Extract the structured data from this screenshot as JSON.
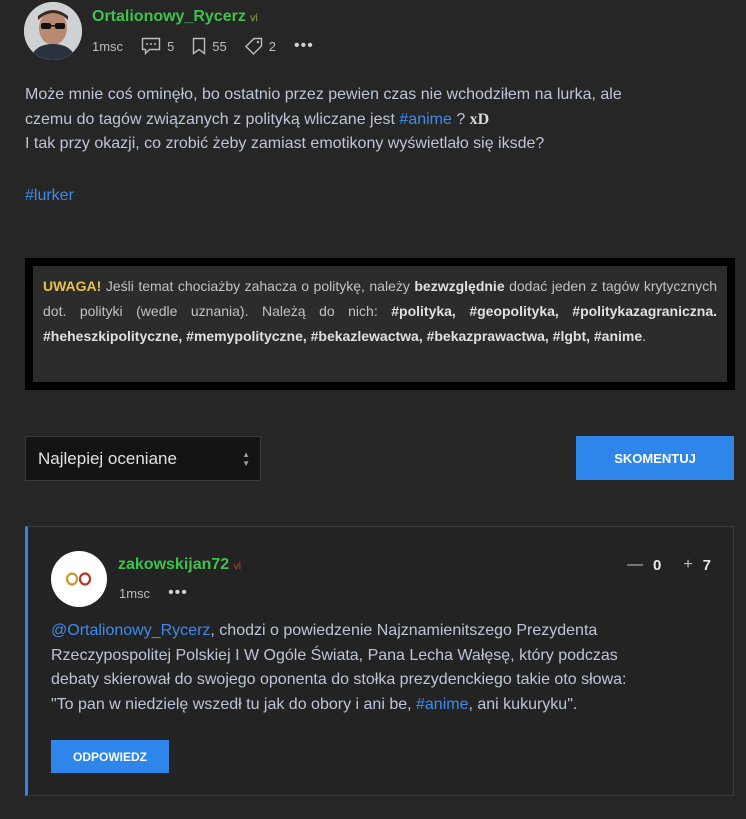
{
  "post": {
    "author": "Ortalionowy_Rycerz",
    "rss_glyph": "ⅵ",
    "time": "1msc",
    "comments": "5",
    "saved": "55",
    "tags_count": "2",
    "more": "•••",
    "body": {
      "l1": "Może mnie coś ominęło, bo ostatnio przez pewien czas nie wchodziłem na lurka, ale",
      "l2a": "czemu do tagów związanych z polityką wliczane jest ",
      "l2tag": "#anime",
      "l2b": " ? ",
      "l2xd": "xD",
      "l3": "I tak przy okazji, co zrobić żeby zamiast emotikony wyświetlało się iksde?"
    },
    "tag": "#lurker"
  },
  "warning": {
    "uwaga": "UWAGA!",
    "t1": " Jeśli temat chociażby zahacza o politykę, należy ",
    "strong1": "bezwzględnie",
    "t2": " dodać jeden z tagów krytycznych dot. polityki (wedle uznania). Należą do nich: ",
    "tags": "#polityka, #geopolityka, #politykazagraniczna. #heheszkipolityczne, #memypolityczne, #bekazlewactwa, #bekazprawactwa, #lgbt, #anime",
    "t3": "."
  },
  "controls": {
    "sort_label": "Najlepiej oceniane",
    "comment_button": "SKOMENTUJ"
  },
  "comment": {
    "author": "zakowskijan72",
    "time": "1msc",
    "more": "•••",
    "minus": "—",
    "minus_count": "0",
    "plus": "+",
    "plus_count": "7",
    "mention": "@Ortalionowy_Rycerz",
    "b1": ", chodzi o powiedzenie Najznamienitszego Prezydenta Rzeczypospolitej Polskiej I W Ogóle Świata, Pana Lecha Wałęsę, który podczas debaty skierował do swojego oponenta do stołka prezydenckiego takie oto słowa:",
    "quote_a": "\"To pan w niedzielę wszedł tu jak do obory i ani be, ",
    "quote_tag": "#anime",
    "quote_b": ", ani kukuryku\".",
    "reply_button": "ODPOWIEDZ"
  },
  "colors": {
    "accent": "#2e86ea",
    "username": "#3fc24c",
    "warning": "#e6c24a"
  }
}
